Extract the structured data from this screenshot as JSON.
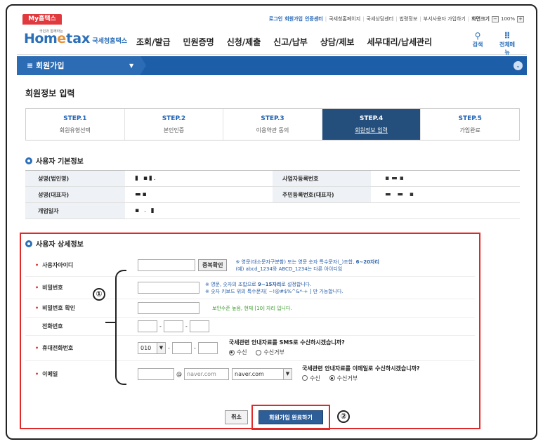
{
  "top": {
    "my_tab": "My홈택스",
    "util": {
      "login": "로그인",
      "signup": "회원가입",
      "cert": "인증센터",
      "links": [
        "국세청홈페이지",
        "국세상담센터",
        "법령정보",
        "부서사용자 가입하기"
      ],
      "screen_size_label": "화면크기",
      "zoom_minus": "−",
      "zoom": "100%",
      "zoom_plus": "+"
    }
  },
  "header": {
    "logo_tiny": "국민과 함께하는",
    "logo_home": "Hom",
    "logo_dot": "e",
    "logo_tax": "tax",
    "logo_kname": "국세청홈택스",
    "nav": [
      "조회/발급",
      "민원증명",
      "신청/제출",
      "신고/납부",
      "상담/제보",
      "세무대리/납세관리"
    ],
    "search_label": "검색",
    "search_glyph": "⚲",
    "allmenu_label": "전체메뉴",
    "allmenu_glyph": "⠿"
  },
  "menubar": {
    "title": "≡  회원가입",
    "caret": "▼",
    "circle": "⌄"
  },
  "page_title": "회원정보 입력",
  "steps": [
    {
      "num": "STEP.1",
      "label": "회원유형선택"
    },
    {
      "num": "STEP.2",
      "label": "본인인증"
    },
    {
      "num": "STEP.3",
      "label": "이용약관 동의"
    },
    {
      "num": "STEP.4",
      "label": "회원정보 입력",
      "active": true
    },
    {
      "num": "STEP.5",
      "label": "가입완료"
    }
  ],
  "basic": {
    "title": "사용자 기본정보",
    "rows": [
      {
        "k": "성명(법인명)",
        "v": "▮ ▪▮.",
        "k2": "사업자등록번호",
        "v2": "▪▬▪"
      },
      {
        "k": "성명(대표자)",
        "v": "▬▪",
        "k2": "주민등록번호(대표자)",
        "v2": "▬ ▬ ▪"
      },
      {
        "k": "개업일자",
        "v": "▪ . ▮",
        "k2": "",
        "v2": ""
      }
    ]
  },
  "detail": {
    "title": "사용자 상세정보",
    "id": {
      "label": "사용자아이디",
      "dup_button": "중복확인",
      "hint1a": "※ 영문(대소문자구분함) 또는 영문 숫자 특수문자(_)조합, ",
      "hint1b": "6~20자리",
      "hint2": "(예) abcd_1234와 ABCD_1234는 다른 아이디임"
    },
    "pw": {
      "label": "비밀번호",
      "hint1a": "※ 영문, 숫자의 조합으로 ",
      "hint1b": "9~15자리",
      "hint1c": "로 설정합니다.",
      "hint2": "※ 숫자 키보드 위의 특수문자[ ~!@#$%^&*-+ ] 만 가능합니다."
    },
    "pw_confirm": {
      "label": "비밀번호 확인",
      "hint": "보안수준 높음, 현재 [10] 자리 입니다."
    },
    "phone": {
      "label": "전화번호"
    },
    "mobile": {
      "label": "휴대전화번호",
      "prefix": "010",
      "question": "국세관련 안내자료를 SMS로 수신하시겠습니까?",
      "opt_yes": "수신",
      "opt_no": "수신거부"
    },
    "email": {
      "label": "이메일",
      "at": "@",
      "domain_value": "naver.com",
      "domain_select": "naver.com",
      "question": "국세관련 안내자료를 이메일로 수신하시겠습니까?",
      "opt_yes": "수신",
      "opt_no": "수신거부"
    }
  },
  "buttons": {
    "cancel": "취소",
    "submit": "회원가입 완료하기"
  },
  "annotations": {
    "one": "①",
    "two": "②"
  }
}
